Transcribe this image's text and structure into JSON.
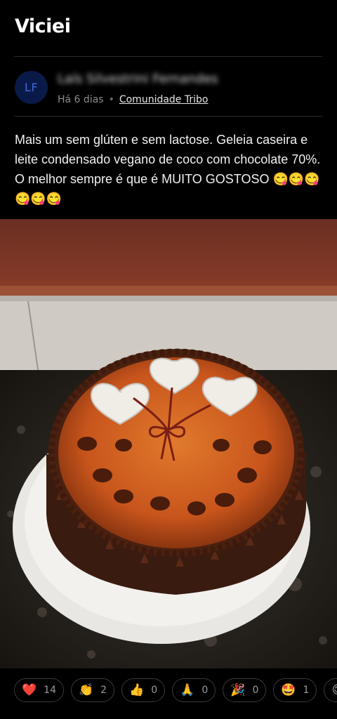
{
  "header": {
    "title": "Viciei"
  },
  "author": {
    "initials": "LF",
    "name": "Laís Silvestrini Fernandes",
    "time": "Há 6 dias",
    "separator": "•",
    "community": "Comunidade Tribo"
  },
  "post": {
    "text": "Mais um sem glúten e sem lactose. Geleia caseira e leite condensado vegano de coco com chocolate 70%. O melhor sempre é que é MUITO GOSTOSO 😋😋😋😋😋😋"
  },
  "reactions": [
    {
      "icon": "heart",
      "emoji": "❤️",
      "count": "14"
    },
    {
      "icon": "clapping-hands",
      "emoji": "👏",
      "count": "2"
    },
    {
      "icon": "thumbs-up",
      "emoji": "👍",
      "count": "0"
    },
    {
      "icon": "folded-hands",
      "emoji": "🙏",
      "count": "0"
    },
    {
      "icon": "party-popper",
      "emoji": "🎉",
      "count": "0"
    },
    {
      "icon": "star-struck",
      "emoji": "🤩",
      "count": "1"
    },
    {
      "icon": "yum-face",
      "emoji": "😋",
      "count": ""
    }
  ]
}
